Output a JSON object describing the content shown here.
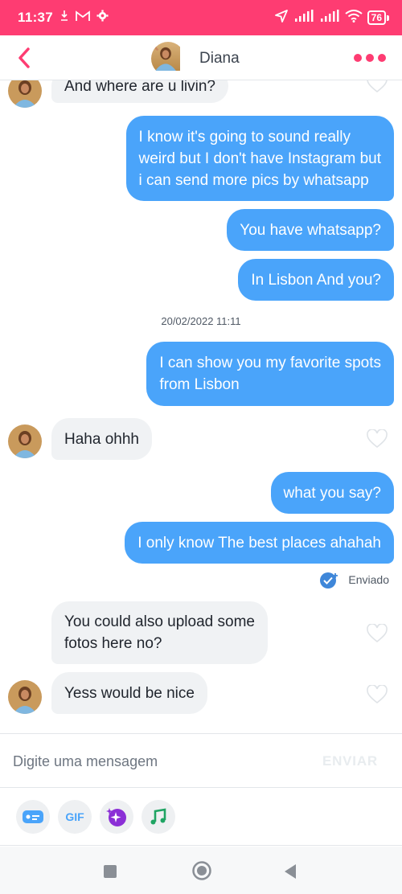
{
  "status_bar": {
    "time": "11:37",
    "battery": "76",
    "icons": [
      "notification-icon",
      "gmail-icon",
      "settings-icon",
      "location-icon",
      "signal-icon",
      "signal-icon",
      "wifi-icon",
      "battery-icon"
    ]
  },
  "header": {
    "contact_name": "Diana",
    "icons": [
      "back-chevron-icon",
      "avatar",
      "more-dots-icon"
    ]
  },
  "messages": [
    {
      "side": "received",
      "text": "And where are u livin?",
      "partial": true
    },
    {
      "side": "sent",
      "text": "I know it's going to sound really\nweird but I don't have Instagram but\ni can send more pics by whatsapp"
    },
    {
      "side": "sent",
      "text": "You have whatsapp?"
    },
    {
      "side": "sent",
      "text": "In Lisbon And you?"
    },
    {
      "type": "timestamp",
      "text": "20/02/2022 11:11"
    },
    {
      "side": "sent",
      "text": "I can show you my favorite spots\nfrom Lisbon"
    },
    {
      "side": "received",
      "text": "Haha ohhh"
    },
    {
      "side": "sent",
      "text": "what you say?"
    },
    {
      "side": "sent",
      "text": "I only know The best places ahahah"
    },
    {
      "type": "status",
      "text": "Enviado"
    },
    {
      "side": "received",
      "text": "You could also upload some\nfotos here no?"
    },
    {
      "side": "received",
      "text": "Yess would be nice"
    }
  ],
  "composer": {
    "placeholder": "Digite uma mensagem",
    "send_label": "ENVIAR"
  },
  "toolbar": {
    "gif_label": "GIF",
    "tools": [
      "contact-card-icon",
      "gif-icon",
      "sparkle-sticker-icon",
      "music-note-icon"
    ]
  },
  "colors": {
    "brand": "#fe3c72",
    "sent_bubble": "#4aa4fa",
    "received_bubble": "#f0f2f4"
  }
}
